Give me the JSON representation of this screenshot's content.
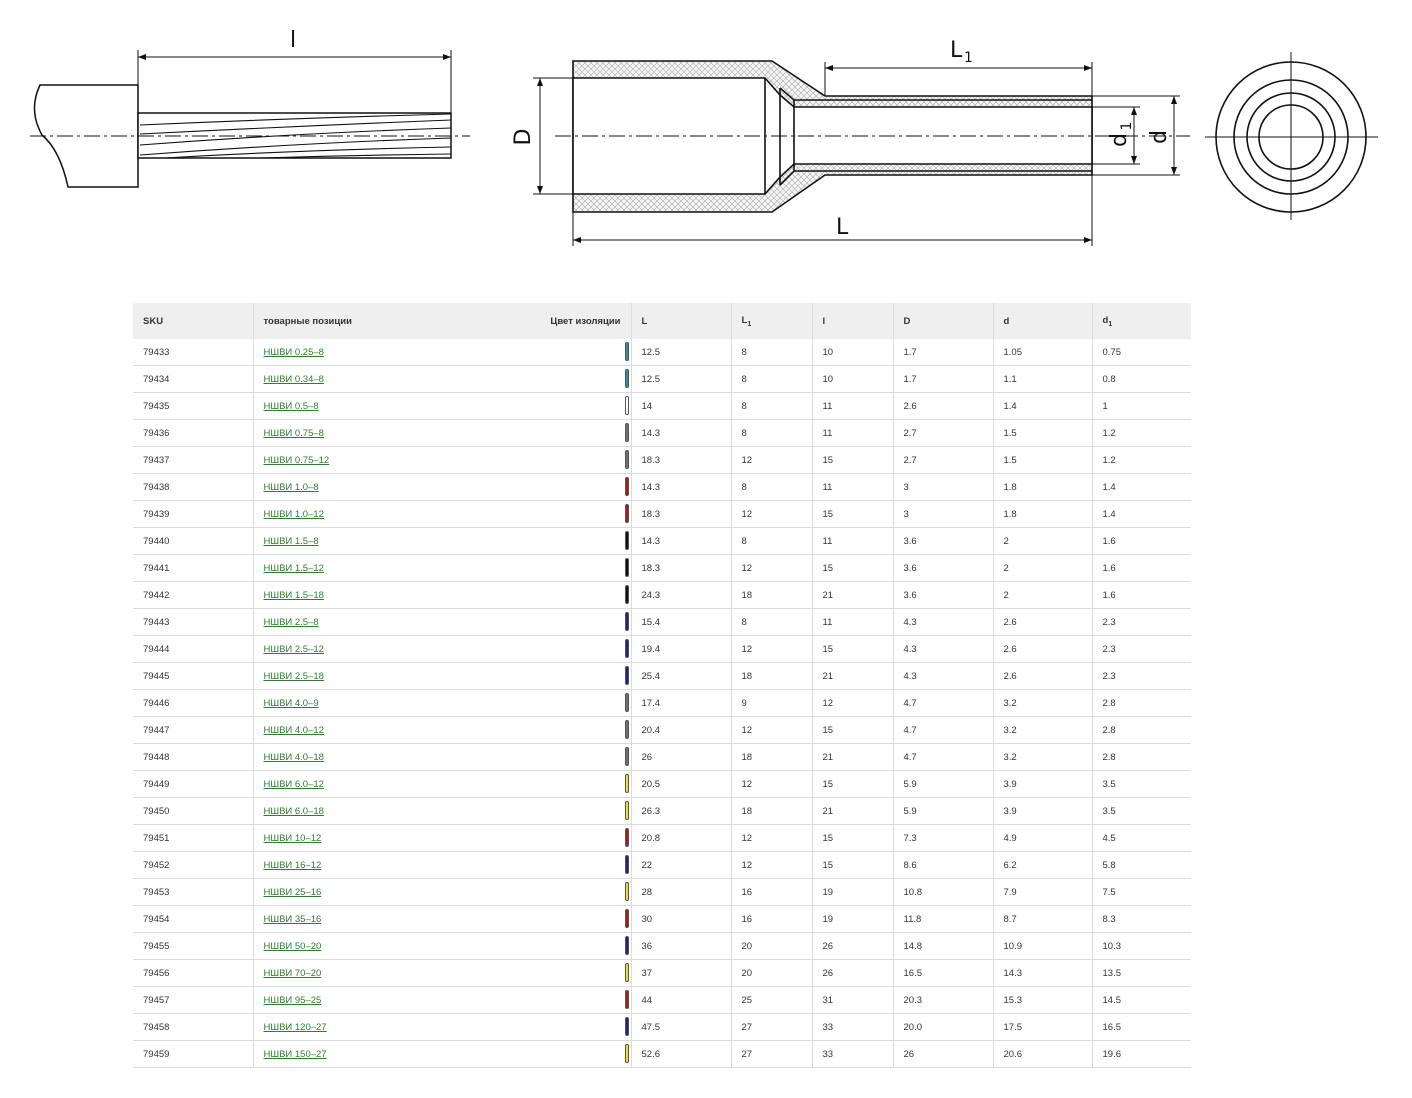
{
  "drawing": {
    "labels": {
      "strip_length": "l",
      "outer_diameter": "D",
      "tube_length": "L",
      "tube_length_sub": "1",
      "total_length": "L",
      "inner_diameter": "d",
      "inner_diameter_sub": "1",
      "outer_tube_diameter": "d"
    }
  },
  "table": {
    "headers": {
      "sku": "SKU",
      "name": "товарные позиции",
      "color": "Цвет изоляции",
      "L": "L",
      "L1": "L",
      "L1_sub": "1",
      "l": "l",
      "D": "D",
      "d": "d",
      "d1": "d",
      "d1_sub": "1"
    },
    "colors": {
      "turquoise": "#2a8fa8",
      "white": "#ffffff",
      "grey": "#707070",
      "red": "#b01818",
      "black": "#111111",
      "blue": "#1a2480",
      "yellow": "#f2df2a",
      "link": "#2e7d32"
    },
    "rows": [
      {
        "sku": "79433",
        "name": "НШВИ 0.25–8",
        "color": "turquoise",
        "L": "12.5",
        "L1": "8",
        "l": "10",
        "D": "1.7",
        "d": "1.05",
        "d1": "0.75"
      },
      {
        "sku": "79434",
        "name": "НШВИ 0.34–8",
        "color": "turquoise",
        "L": "12.5",
        "L1": "8",
        "l": "10",
        "D": "1.7",
        "d": "1.1",
        "d1": "0.8"
      },
      {
        "sku": "79435",
        "name": "НШВИ 0.5–8",
        "color": "white",
        "L": "14",
        "L1": "8",
        "l": "11",
        "D": "2.6",
        "d": "1.4",
        "d1": "1"
      },
      {
        "sku": "79436",
        "name": "НШВИ 0.75–8",
        "color": "grey",
        "L": "14.3",
        "L1": "8",
        "l": "11",
        "D": "2.7",
        "d": "1.5",
        "d1": "1.2"
      },
      {
        "sku": "79437",
        "name": "НШВИ 0.75–12",
        "color": "grey",
        "L": "18.3",
        "L1": "12",
        "l": "15",
        "D": "2.7",
        "d": "1.5",
        "d1": "1.2"
      },
      {
        "sku": "79438",
        "name": "НШВИ 1.0–8",
        "color": "red",
        "L": "14.3",
        "L1": "8",
        "l": "11",
        "D": "3",
        "d": "1.8",
        "d1": "1.4"
      },
      {
        "sku": "79439",
        "name": "НШВИ 1.0–12",
        "color": "red",
        "L": "18.3",
        "L1": "12",
        "l": "15",
        "D": "3",
        "d": "1.8",
        "d1": "1.4"
      },
      {
        "sku": "79440",
        "name": "НШВИ 1.5–8",
        "color": "black",
        "L": "14.3",
        "L1": "8",
        "l": "11",
        "D": "3.6",
        "d": "2",
        "d1": "1.6"
      },
      {
        "sku": "79441",
        "name": "НШВИ 1.5–12",
        "color": "black",
        "L": "18.3",
        "L1": "12",
        "l": "15",
        "D": "3.6",
        "d": "2",
        "d1": "1.6"
      },
      {
        "sku": "79442",
        "name": "НШВИ 1.5–18",
        "color": "black",
        "L": "24.3",
        "L1": "18",
        "l": "21",
        "D": "3.6",
        "d": "2",
        "d1": "1.6"
      },
      {
        "sku": "79443",
        "name": "НШВИ 2.5–8",
        "color": "blue",
        "L": "15.4",
        "L1": "8",
        "l": "11",
        "D": "4.3",
        "d": "2.6",
        "d1": "2.3"
      },
      {
        "sku": "79444",
        "name": "НШВИ 2.5–12",
        "color": "blue",
        "L": "19.4",
        "L1": "12",
        "l": "15",
        "D": "4.3",
        "d": "2.6",
        "d1": "2.3"
      },
      {
        "sku": "79445",
        "name": "НШВИ 2.5–18",
        "color": "blue",
        "L": "25.4",
        "L1": "18",
        "l": "21",
        "D": "4.3",
        "d": "2.6",
        "d1": "2.3"
      },
      {
        "sku": "79446",
        "name": "НШВИ 4.0–9",
        "color": "grey",
        "L": "17.4",
        "L1": "9",
        "l": "12",
        "D": "4.7",
        "d": "3.2",
        "d1": "2.8"
      },
      {
        "sku": "79447",
        "name": "НШВИ 4.0–12",
        "color": "grey",
        "L": "20.4",
        "L1": "12",
        "l": "15",
        "D": "4.7",
        "d": "3.2",
        "d1": "2.8"
      },
      {
        "sku": "79448",
        "name": "НШВИ 4.0–18",
        "color": "grey",
        "L": "26",
        "L1": "18",
        "l": "21",
        "D": "4.7",
        "d": "3.2",
        "d1": "2.8"
      },
      {
        "sku": "79449",
        "name": "НШВИ 6.0–12",
        "color": "yellow",
        "L": "20.5",
        "L1": "12",
        "l": "15",
        "D": "5.9",
        "d": "3.9",
        "d1": "3.5"
      },
      {
        "sku": "79450",
        "name": "НШВИ 6.0–18",
        "color": "yellow",
        "L": "26.3",
        "L1": "18",
        "l": "21",
        "D": "5.9",
        "d": "3.9",
        "d1": "3.5"
      },
      {
        "sku": "79451",
        "name": "НШВИ 10–12",
        "color": "red",
        "L": "20.8",
        "L1": "12",
        "l": "15",
        "D": "7.3",
        "d": "4.9",
        "d1": "4.5"
      },
      {
        "sku": "79452",
        "name": "НШВИ 16–12",
        "color": "blue",
        "L": "22",
        "L1": "12",
        "l": "15",
        "D": "8.6",
        "d": "6.2",
        "d1": "5.8"
      },
      {
        "sku": "79453",
        "name": "НШВИ 25–16",
        "color": "yellow",
        "L": "28",
        "L1": "16",
        "l": "19",
        "D": "10.8",
        "d": "7.9",
        "d1": "7.5"
      },
      {
        "sku": "79454",
        "name": "НШВИ 35–16",
        "color": "red",
        "L": "30",
        "L1": "16",
        "l": "19",
        "D": "11.8",
        "d": "8.7",
        "d1": "8.3"
      },
      {
        "sku": "79455",
        "name": "НШВИ 50–20",
        "color": "blue",
        "L": "36",
        "L1": "20",
        "l": "26",
        "D": "14.8",
        "d": "10.9",
        "d1": "10.3"
      },
      {
        "sku": "79456",
        "name": "НШВИ 70–20",
        "color": "yellow",
        "L": "37",
        "L1": "20",
        "l": "26",
        "D": "16.5",
        "d": "14.3",
        "d1": "13.5"
      },
      {
        "sku": "79457",
        "name": "НШВИ 95–25",
        "color": "red",
        "L": "44",
        "L1": "25",
        "l": "31",
        "D": "20.3",
        "d": "15.3",
        "d1": "14.5"
      },
      {
        "sku": "79458",
        "name": "НШВИ 120–27",
        "color": "blue",
        "L": "47.5",
        "L1": "27",
        "l": "33",
        "D": "20.0",
        "d": "17.5",
        "d1": "16.5"
      },
      {
        "sku": "79459",
        "name": "НШВИ 150–27",
        "color": "yellow",
        "L": "52.6",
        "L1": "27",
        "l": "33",
        "D": "26",
        "d": "20.6",
        "d1": "19.6"
      }
    ]
  }
}
